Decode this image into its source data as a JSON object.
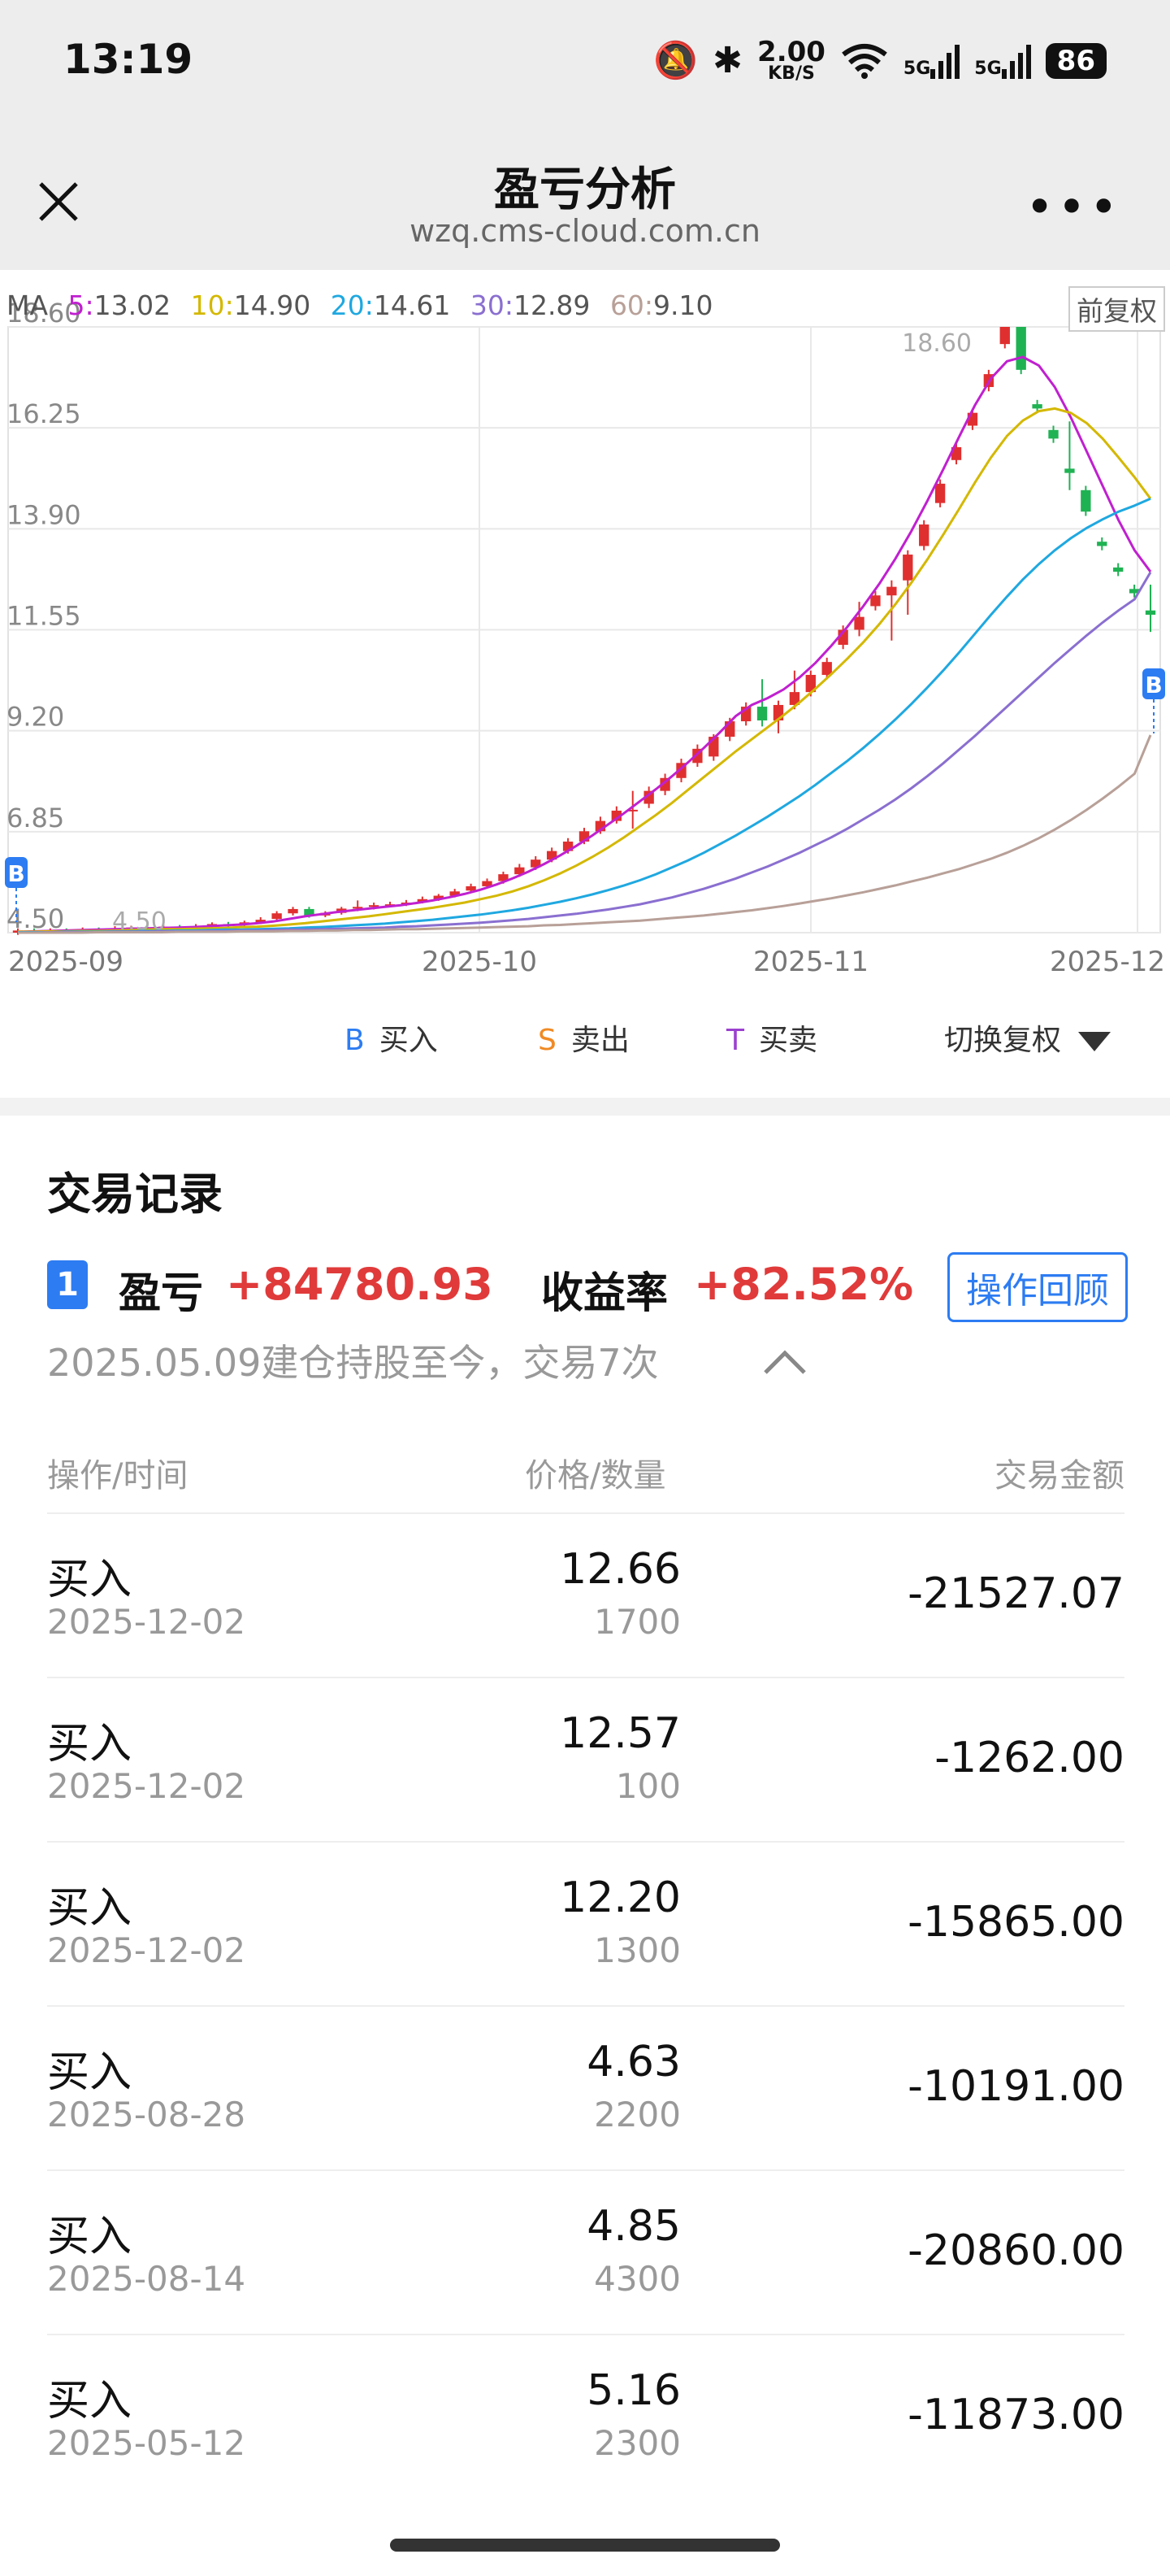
{
  "status_bar": {
    "time": "13:19",
    "speed_value": "2.00",
    "speed_unit": "KB/S",
    "net_label_1": "5G",
    "net_label_2": "5G",
    "battery": "86"
  },
  "nav": {
    "title": "盈亏分析",
    "url": "wzq.cms-cloud.com.cn"
  },
  "chart": {
    "ma_prefix": "MA",
    "ma": [
      {
        "period": "5:",
        "value": "13.02",
        "color": "#c020d0"
      },
      {
        "period": "10:",
        "value": "14.90",
        "color": "#d4b800"
      },
      {
        "period": "20:",
        "value": "14.61",
        "color": "#1fa8e0"
      },
      {
        "period": "30:",
        "value": "12.89",
        "color": "#8a6fd0"
      },
      {
        "period": "60:",
        "value": "9.10",
        "color": "#b8a098"
      }
    ],
    "fuquan_tag": "前复权",
    "high_label": "18.60",
    "low_label": "4.50"
  },
  "chart_data": {
    "type": "candlestick",
    "y_ticks": [
      "18.60",
      "16.25",
      "13.90",
      "11.55",
      "9.20",
      "6.85",
      "4.50"
    ],
    "x_ticks": [
      "2025-09",
      "2025-10",
      "2025-11",
      "2025-12"
    ],
    "ylim": [
      4.5,
      18.6
    ],
    "grid": true,
    "annotations": [
      "18.60",
      "4.50"
    ],
    "marker_label": "B",
    "candles": [
      {
        "o": 4.5,
        "c": 4.55,
        "h": 4.6,
        "l": 4.45
      },
      {
        "o": 4.55,
        "c": 4.52,
        "h": 4.6,
        "l": 4.48
      },
      {
        "o": 4.52,
        "c": 4.56,
        "h": 4.6,
        "l": 4.48
      },
      {
        "o": 4.56,
        "c": 4.55,
        "h": 4.6,
        "l": 4.5
      },
      {
        "o": 4.55,
        "c": 4.58,
        "h": 4.62,
        "l": 4.5
      },
      {
        "o": 4.58,
        "c": 4.56,
        "h": 4.62,
        "l": 4.52
      },
      {
        "o": 4.56,
        "c": 4.6,
        "h": 4.65,
        "l": 4.52
      },
      {
        "o": 4.6,
        "c": 4.62,
        "h": 4.66,
        "l": 4.55
      },
      {
        "o": 4.62,
        "c": 4.6,
        "h": 4.66,
        "l": 4.56
      },
      {
        "o": 4.6,
        "c": 4.64,
        "h": 4.68,
        "l": 4.56
      },
      {
        "o": 4.64,
        "c": 4.62,
        "h": 4.68,
        "l": 4.58
      },
      {
        "o": 4.62,
        "c": 4.65,
        "h": 4.7,
        "l": 4.58
      },
      {
        "o": 4.65,
        "c": 4.7,
        "h": 4.74,
        "l": 4.6
      },
      {
        "o": 4.7,
        "c": 4.68,
        "h": 4.75,
        "l": 4.64
      },
      {
        "o": 4.68,
        "c": 4.74,
        "h": 4.78,
        "l": 4.64
      },
      {
        "o": 4.74,
        "c": 4.8,
        "h": 4.86,
        "l": 4.7
      },
      {
        "o": 4.82,
        "c": 4.95,
        "h": 5.0,
        "l": 4.78
      },
      {
        "o": 4.95,
        "c": 5.05,
        "h": 5.1,
        "l": 4.9
      },
      {
        "o": 5.05,
        "c": 4.9,
        "h": 5.1,
        "l": 4.85
      },
      {
        "o": 4.9,
        "c": 4.96,
        "h": 5.0,
        "l": 4.86
      },
      {
        "o": 4.96,
        "c": 5.06,
        "h": 5.1,
        "l": 4.92
      },
      {
        "o": 5.06,
        "c": 5.1,
        "h": 5.25,
        "l": 5.0
      },
      {
        "o": 5.1,
        "c": 5.14,
        "h": 5.2,
        "l": 5.04
      },
      {
        "o": 5.14,
        "c": 5.16,
        "h": 5.22,
        "l": 5.1
      },
      {
        "o": 5.16,
        "c": 5.2,
        "h": 5.26,
        "l": 5.12
      },
      {
        "o": 5.22,
        "c": 5.28,
        "h": 5.34,
        "l": 5.18
      },
      {
        "o": 5.28,
        "c": 5.36,
        "h": 5.4,
        "l": 5.24
      },
      {
        "o": 5.36,
        "c": 5.46,
        "h": 5.52,
        "l": 5.32
      },
      {
        "o": 5.48,
        "c": 5.58,
        "h": 5.64,
        "l": 5.42
      },
      {
        "o": 5.58,
        "c": 5.7,
        "h": 5.76,
        "l": 5.54
      },
      {
        "o": 5.7,
        "c": 5.86,
        "h": 5.92,
        "l": 5.64
      },
      {
        "o": 5.86,
        "c": 6.02,
        "h": 6.1,
        "l": 5.8
      },
      {
        "o": 6.02,
        "c": 6.2,
        "h": 6.28,
        "l": 5.96
      },
      {
        "o": 6.2,
        "c": 6.4,
        "h": 6.48,
        "l": 6.14
      },
      {
        "o": 6.4,
        "c": 6.62,
        "h": 6.7,
        "l": 6.34
      },
      {
        "o": 6.62,
        "c": 6.86,
        "h": 6.94,
        "l": 6.56
      },
      {
        "o": 6.86,
        "c": 7.1,
        "h": 7.2,
        "l": 6.8
      },
      {
        "o": 7.1,
        "c": 7.34,
        "h": 7.44,
        "l": 7.04
      },
      {
        "o": 7.34,
        "c": 7.36,
        "h": 7.8,
        "l": 6.92
      },
      {
        "o": 7.5,
        "c": 7.8,
        "h": 7.9,
        "l": 7.4
      },
      {
        "o": 7.8,
        "c": 8.1,
        "h": 8.2,
        "l": 7.7
      },
      {
        "o": 8.1,
        "c": 8.45,
        "h": 8.55,
        "l": 8.0
      },
      {
        "o": 8.45,
        "c": 8.78,
        "h": 8.88,
        "l": 8.36
      },
      {
        "o": 8.6,
        "c": 9.06,
        "h": 9.12,
        "l": 8.5
      },
      {
        "o": 9.06,
        "c": 9.42,
        "h": 9.5,
        "l": 8.96
      },
      {
        "o": 9.42,
        "c": 9.76,
        "h": 9.86,
        "l": 9.32
      },
      {
        "o": 9.76,
        "c": 9.44,
        "h": 10.4,
        "l": 9.3
      },
      {
        "o": 9.44,
        "c": 9.8,
        "h": 9.9,
        "l": 9.14
      },
      {
        "o": 9.8,
        "c": 10.1,
        "h": 10.6,
        "l": 9.7
      },
      {
        "o": 10.1,
        "c": 10.5,
        "h": 10.6,
        "l": 10.0
      },
      {
        "o": 10.5,
        "c": 10.8,
        "h": 10.9,
        "l": 10.4
      },
      {
        "o": 11.2,
        "c": 11.55,
        "h": 11.65,
        "l": 11.1
      },
      {
        "o": 11.55,
        "c": 11.85,
        "h": 12.2,
        "l": 11.4
      },
      {
        "o": 12.1,
        "c": 12.35,
        "h": 12.45,
        "l": 12.0
      },
      {
        "o": 12.35,
        "c": 12.55,
        "h": 12.7,
        "l": 11.3
      },
      {
        "o": 12.7,
        "c": 13.3,
        "h": 13.4,
        "l": 11.9
      },
      {
        "o": 13.5,
        "c": 14.0,
        "h": 14.1,
        "l": 13.4
      },
      {
        "o": 14.5,
        "c": 14.95,
        "h": 15.05,
        "l": 14.4
      },
      {
        "o": 15.5,
        "c": 15.8,
        "h": 15.9,
        "l": 15.4
      },
      {
        "o": 16.3,
        "c": 16.6,
        "h": 16.7,
        "l": 16.2
      },
      {
        "o": 17.2,
        "c": 17.5,
        "h": 17.6,
        "l": 17.1
      },
      {
        "o": 18.2,
        "c": 18.6,
        "h": 18.6,
        "l": 18.1
      },
      {
        "o": 18.6,
        "c": 17.6,
        "h": 18.6,
        "l": 17.5
      },
      {
        "o": 16.8,
        "c": 16.7,
        "h": 16.9,
        "l": 16.6
      },
      {
        "o": 16.2,
        "c": 16.0,
        "h": 16.3,
        "l": 15.9
      },
      {
        "o": 15.3,
        "c": 15.2,
        "h": 16.4,
        "l": 14.8
      },
      {
        "o": 14.8,
        "c": 14.3,
        "h": 14.9,
        "l": 14.2
      },
      {
        "o": 13.6,
        "c": 13.5,
        "h": 13.7,
        "l": 13.4
      },
      {
        "o": 13.0,
        "c": 12.9,
        "h": 13.1,
        "l": 12.8
      },
      {
        "o": 12.5,
        "c": 12.4,
        "h": 12.6,
        "l": 12.3
      },
      {
        "o": 12.0,
        "c": 11.9,
        "h": 12.6,
        "l": 11.5
      }
    ],
    "series": [
      {
        "name": "MA5",
        "values": [
          4.52,
          4.53,
          4.54,
          4.55,
          4.56,
          4.57,
          4.58,
          4.59,
          4.6,
          4.61,
          4.62,
          4.63,
          4.65,
          4.67,
          4.69,
          4.72,
          4.76,
          4.82,
          4.88,
          4.93,
          4.98,
          5.02,
          5.06,
          5.1,
          5.14,
          5.19,
          5.25,
          5.32,
          5.4,
          5.5,
          5.62,
          5.76,
          5.92,
          6.1,
          6.3,
          6.52,
          6.76,
          7.02,
          7.28,
          7.56,
          7.84,
          8.14,
          8.46,
          8.8,
          9.16,
          9.54,
          9.8,
          9.96,
          10.16,
          10.44,
          10.78,
          11.18,
          11.62,
          12.1,
          12.62,
          13.2,
          13.84,
          14.54,
          15.28,
          16.04,
          16.78,
          17.4,
          17.8,
          17.9,
          17.7,
          17.2,
          16.5,
          15.7,
          14.9,
          14.1,
          13.4,
          12.9
        ]
      },
      {
        "name": "MA10",
        "values": [
          4.52,
          4.52,
          4.53,
          4.53,
          4.54,
          4.54,
          4.55,
          4.56,
          4.57,
          4.58,
          4.58,
          4.59,
          4.6,
          4.61,
          4.63,
          4.64,
          4.66,
          4.69,
          4.72,
          4.76,
          4.8,
          4.84,
          4.88,
          4.93,
          4.98,
          5.03,
          5.08,
          5.14,
          5.2,
          5.28,
          5.36,
          5.46,
          5.58,
          5.72,
          5.88,
          6.06,
          6.26,
          6.48,
          6.72,
          6.98,
          7.24,
          7.52,
          7.82,
          8.12,
          8.42,
          8.72,
          9.0,
          9.28,
          9.56,
          9.86,
          10.18,
          10.52,
          10.88,
          11.26,
          11.68,
          12.14,
          12.64,
          13.18,
          13.76,
          14.36,
          14.98,
          15.56,
          16.06,
          16.42,
          16.64,
          16.7,
          16.6,
          16.36,
          16.0,
          15.56,
          15.1,
          14.6
        ]
      },
      {
        "name": "MA20",
        "values": [
          4.51,
          4.51,
          4.51,
          4.52,
          4.52,
          4.52,
          4.53,
          4.53,
          4.54,
          4.54,
          4.55,
          4.55,
          4.56,
          4.57,
          4.57,
          4.58,
          4.59,
          4.6,
          4.62,
          4.63,
          4.65,
          4.67,
          4.69,
          4.71,
          4.74,
          4.77,
          4.8,
          4.84,
          4.88,
          4.92,
          4.97,
          5.02,
          5.08,
          5.15,
          5.22,
          5.3,
          5.39,
          5.49,
          5.6,
          5.72,
          5.86,
          6.02,
          6.18,
          6.36,
          6.56,
          6.76,
          6.98,
          7.2,
          7.44,
          7.68,
          7.94,
          8.22,
          8.5,
          8.8,
          9.12,
          9.46,
          9.82,
          10.2,
          10.6,
          11.02,
          11.46,
          11.9,
          12.32,
          12.72,
          13.08,
          13.4,
          13.68,
          13.92,
          14.12,
          14.3,
          14.44,
          14.6
        ]
      },
      {
        "name": "MA30",
        "values": [
          4.5,
          4.5,
          4.51,
          4.51,
          4.51,
          4.51,
          4.52,
          4.52,
          4.52,
          4.53,
          4.53,
          4.53,
          4.54,
          4.54,
          4.55,
          4.55,
          4.56,
          4.57,
          4.57,
          4.58,
          4.59,
          4.6,
          4.61,
          4.62,
          4.64,
          4.65,
          4.67,
          4.69,
          4.71,
          4.73,
          4.76,
          4.79,
          4.82,
          4.86,
          4.9,
          4.94,
          4.99,
          5.04,
          5.1,
          5.16,
          5.24,
          5.32,
          5.42,
          5.52,
          5.64,
          5.76,
          5.9,
          6.04,
          6.2,
          6.36,
          6.54,
          6.72,
          6.92,
          7.14,
          7.36,
          7.6,
          7.86,
          8.14,
          8.44,
          8.76,
          9.08,
          9.42,
          9.76,
          10.1,
          10.44,
          10.78,
          11.1,
          11.42,
          11.72,
          12.0,
          12.26,
          12.89
        ]
      },
      {
        "name": "MA60",
        "values": [
          4.5,
          4.5,
          4.5,
          4.5,
          4.5,
          4.51,
          4.51,
          4.51,
          4.51,
          4.51,
          4.52,
          4.52,
          4.52,
          4.52,
          4.53,
          4.53,
          4.53,
          4.54,
          4.54,
          4.55,
          4.55,
          4.56,
          4.56,
          4.57,
          4.58,
          4.58,
          4.59,
          4.6,
          4.61,
          4.62,
          4.63,
          4.64,
          4.65,
          4.67,
          4.68,
          4.7,
          4.72,
          4.74,
          4.76,
          4.78,
          4.81,
          4.84,
          4.87,
          4.9,
          4.94,
          4.98,
          5.02,
          5.07,
          5.12,
          5.18,
          5.24,
          5.3,
          5.37,
          5.44,
          5.52,
          5.6,
          5.69,
          5.78,
          5.88,
          5.98,
          6.1,
          6.22,
          6.36,
          6.52,
          6.7,
          6.9,
          7.12,
          7.36,
          7.62,
          7.9,
          8.2,
          9.1
        ]
      }
    ]
  },
  "legend": [
    {
      "letter": "B",
      "label": "买入",
      "color": "#2d7cf2"
    },
    {
      "letter": "S",
      "label": "卖出",
      "color": "#f08a24"
    },
    {
      "letter": "T",
      "label": "买卖",
      "color": "#9b40d0"
    }
  ],
  "switch_fuquan": "切换复权",
  "records": {
    "section_title": "交易记录",
    "index": "1",
    "pnl_label": "盈亏",
    "pnl_value": "+84780.93",
    "rate_label": "收益率",
    "rate_value": "+82.52%",
    "replay_button": "操作回顾",
    "hold_info": "2025.05.09建仓持股至今，交易7次",
    "headers": {
      "op": "操作/时间",
      "price": "价格/数量",
      "amount": "交易金额"
    },
    "rows": [
      {
        "op": "买入",
        "date": "2025-12-02",
        "price": "12.66",
        "qty": "1700",
        "amount": "-21527.07"
      },
      {
        "op": "买入",
        "date": "2025-12-02",
        "price": "12.57",
        "qty": "100",
        "amount": "-1262.00"
      },
      {
        "op": "买入",
        "date": "2025-12-02",
        "price": "12.20",
        "qty": "1300",
        "amount": "-15865.00"
      },
      {
        "op": "买入",
        "date": "2025-08-28",
        "price": "4.63",
        "qty": "2200",
        "amount": "-10191.00"
      },
      {
        "op": "买入",
        "date": "2025-08-14",
        "price": "4.85",
        "qty": "4300",
        "amount": "-20860.00"
      },
      {
        "op": "买入",
        "date": "2025-05-12",
        "price": "5.16",
        "qty": "2300",
        "amount": "-11873.00"
      }
    ]
  }
}
